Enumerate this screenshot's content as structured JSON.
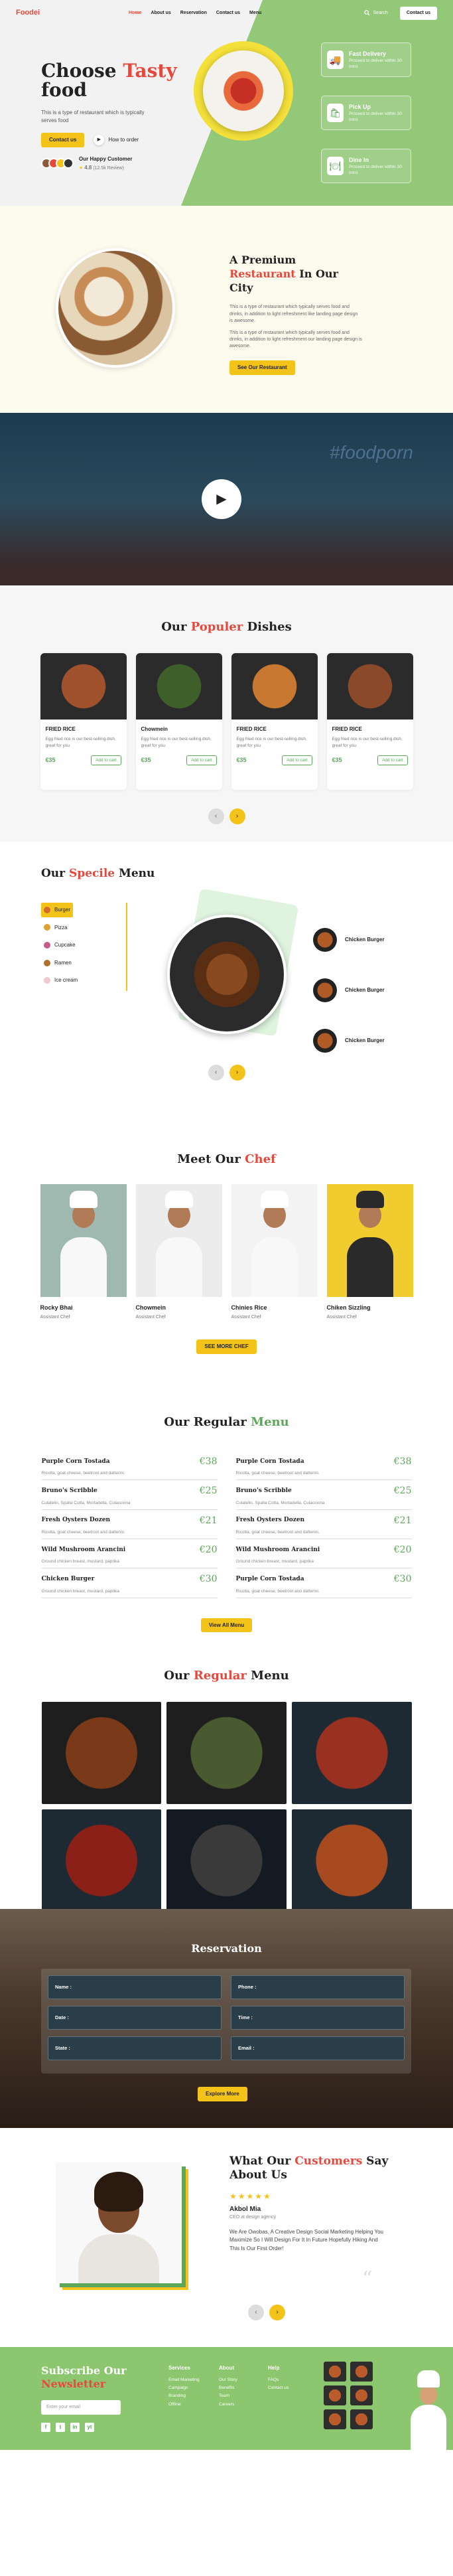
{
  "nav": {
    "logo": "Foodei",
    "links": [
      "Home",
      "About us",
      "Reservation",
      "Contact us",
      "Menu"
    ],
    "search": "Search",
    "contact_button": "Contact us"
  },
  "hero": {
    "title_plain": "Choose ",
    "title_accent": "Tasty",
    "title_second": "food",
    "description": "This is a type of restaurant which is typically serves food",
    "contact_button": "Contact us",
    "video_link": "How to order",
    "happy_title": "Our Happy Customer",
    "rating": "4.8",
    "reviews": "(12.5k Review)",
    "features": [
      {
        "title": "Fast Delivery",
        "text": "Proceed to deliver within 30 mins"
      },
      {
        "title": "Pick Up",
        "text": "Proceed to deliver within 30 mins"
      },
      {
        "title": "Dine In",
        "text": "Proceed to deliver within 30 mins"
      }
    ]
  },
  "about": {
    "title_plain": "A Premium",
    "title_accent": "Restaurant",
    "title_rest": "In Our City",
    "para1": "This is a type of restaurant which typically serves food and drinks, in addition to light refreshment like landing page design is awesome.",
    "para2": "This is a type of restaurant which typically serves food and drinks, in addition to light refreshment our landing page design is awesome.",
    "button": "See Our Restaurant"
  },
  "video": {
    "neon": "#foodporn"
  },
  "dishes": {
    "title_plain": "Our ",
    "title_accent": "Populer",
    "title_rest": " Dishes",
    "cards": [
      {
        "name": "FRIED RICE",
        "desc": "Egg fried rice is our best-selling dish, great for you",
        "price": "€35",
        "button": "Add to cart",
        "color": "#a0522d"
      },
      {
        "name": "Chowmein",
        "desc": "Egg fried rice is our best-selling dish, great for you",
        "price": "€35",
        "button": "Add to cart",
        "color": "#3f5f2a"
      },
      {
        "name": "FRIED RICE",
        "desc": "Egg fried rice is our best-selling dish, great for you",
        "price": "€35",
        "button": "Add to cart",
        "color": "#c87830"
      },
      {
        "name": "FRIED RICE",
        "desc": "Egg fried rice is our best-selling dish, great for you",
        "price": "€35",
        "button": "Add to cart",
        "color": "#8a4a2a"
      }
    ]
  },
  "menu": {
    "title_plain": "Our ",
    "title_accent": "Specile",
    "title_rest": " Menu",
    "categories": [
      {
        "label": "Burger",
        "color": "#d16a2a"
      },
      {
        "label": "Pizza",
        "color": "#e0a030"
      },
      {
        "label": "Cupcake",
        "color": "#c85a8a"
      },
      {
        "label": "Ramen",
        "color": "#b0702a"
      },
      {
        "label": "Ice cream",
        "color": "#f0c8d0"
      }
    ],
    "items": [
      "Chicken Burger",
      "Chicken Burger",
      "Chicken Burger"
    ]
  },
  "chefs": {
    "title_plain": "Meet Our ",
    "title_accent": "Chef",
    "list": [
      {
        "name": "Rocky Bhai",
        "role": "Assistant Chef",
        "bg": "#9fb8b0"
      },
      {
        "name": "Chowmein",
        "role": "Assistant Chef",
        "bg": "#ececec"
      },
      {
        "name": "Chinies Rice",
        "role": "Assistant Chef",
        "bg": "#f3f3f3"
      },
      {
        "name": "Chiken Sizzling",
        "role": "Assistant Chef",
        "bg": "#f0cc2e"
      }
    ],
    "button": "SEE MORE CHEF"
  },
  "regular": {
    "title_plain": "Our Regular ",
    "title_accent": "Menu",
    "items": [
      {
        "name": "Purple Corn Tostada",
        "price": "€38",
        "desc": "Ricotta, goat cheese, beetroot and datterini."
      },
      {
        "name": "Purple Corn Tostada",
        "price": "€38",
        "desc": "Ricotta, goat cheese, beetroot and datterini."
      },
      {
        "name": "Bruno's Scribble",
        "price": "€25",
        "desc": "Culatello, Spalla Cotta, Mortadella, Culacciona"
      },
      {
        "name": "Bruno's Scribble",
        "price": "€25",
        "desc": "Culatello, Spalla Cotta, Mortadella, Culacciona"
      },
      {
        "name": "Fresh Oysters Dozen",
        "price": "€21",
        "desc": "Ricotta, goat cheese, beetroot and datterini."
      },
      {
        "name": "Fresh Oysters Dozen",
        "price": "€21",
        "desc": "Ricotta, goat cheese, beetroot and datterini."
      },
      {
        "name": "Wild Mushroom Arancini",
        "price": "€20",
        "desc": "Ground chicken breast, mustard, paprika"
      },
      {
        "name": "Wild Mushroom Arancini",
        "price": "€20",
        "desc": "Ground chicken breast, mustard, paprika"
      },
      {
        "name": "Chicken Burger",
        "price": "€30",
        "desc": "Ground chicken breast, mustard, paprika"
      },
      {
        "name": "Purple Corn Tostada",
        "price": "€30",
        "desc": "Ricotta, goat cheese, beetroot and datterini."
      }
    ],
    "button": "View All Menu"
  },
  "gallery": {
    "title_plain": "Our ",
    "title_accent": "Regular",
    "title_rest": " Menu",
    "tiles": [
      "#7a3a1a",
      "#4a5a30",
      "#9a3020",
      "#8a2018",
      "#2a2a2a",
      "#a84a20"
    ]
  },
  "reservation": {
    "title": "Reservation",
    "fields": [
      "Name :",
      "Phone :",
      "Date :",
      "Time :",
      "State :",
      "Email :"
    ],
    "button": "Explore More"
  },
  "testimonial": {
    "title_plain": "What Our ",
    "title_accent": "Customers",
    "title_rest": " Say About Us",
    "stars": "★★★★★",
    "name": "Akbol Mia",
    "role": "CEO at design agency",
    "quote": "We Are Owobas, A Creative Design Social Marketing Helping You Maximize So I Will Design For It In Future Hopefully Hiking And This Is Our First Order!",
    "quote_mark": "“"
  },
  "footer": {
    "title_plain": "Subscribe Our",
    "title_accent": "Newsletter",
    "email_placeholder": "Enter your email",
    "social": [
      "f",
      "t",
      "in",
      "yt"
    ],
    "services_title": "Services",
    "services": [
      "Email Marketing",
      "Campaign",
      "Branding",
      "Offline"
    ],
    "about_title": "About",
    "about": [
      "Our Story",
      "Benefits",
      "Team",
      "Careers"
    ],
    "help_title": "Help",
    "help": [
      "FAQs",
      "Contact us"
    ]
  }
}
